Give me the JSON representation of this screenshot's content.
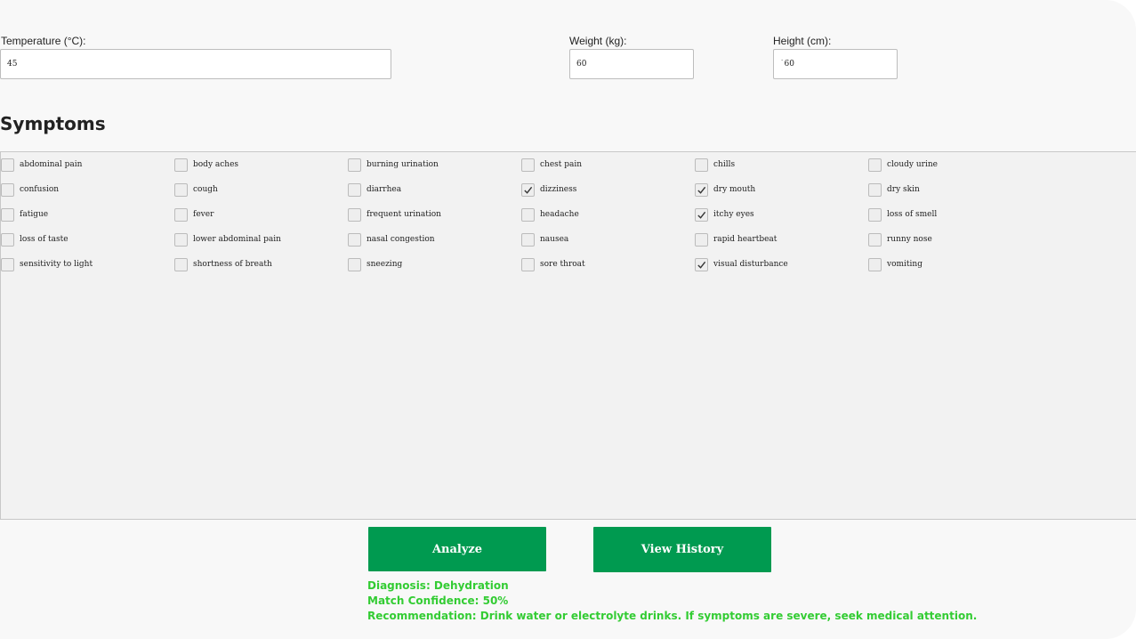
{
  "form": {
    "temperature_label": "Temperature (°C):",
    "temperature_value": "45",
    "weight_label": "Weight (kg):",
    "weight_value": "60",
    "height_label": "Height (cm):",
    "height_value": "`60"
  },
  "symptoms": {
    "title": "Symptoms",
    "items": [
      {
        "label": "abdominal pain",
        "checked": false
      },
      {
        "label": "body aches",
        "checked": false
      },
      {
        "label": "burning urination",
        "checked": false
      },
      {
        "label": "chest pain",
        "checked": false
      },
      {
        "label": "chills",
        "checked": false
      },
      {
        "label": "cloudy urine",
        "checked": false
      },
      {
        "label": "confusion",
        "checked": false
      },
      {
        "label": "cough",
        "checked": false
      },
      {
        "label": "diarrhea",
        "checked": false
      },
      {
        "label": "dizziness",
        "checked": true
      },
      {
        "label": "dry mouth",
        "checked": true
      },
      {
        "label": "dry skin",
        "checked": false
      },
      {
        "label": "fatigue",
        "checked": false
      },
      {
        "label": "fever",
        "checked": false
      },
      {
        "label": "frequent urination",
        "checked": false
      },
      {
        "label": "headache",
        "checked": false
      },
      {
        "label": "itchy eyes",
        "checked": true
      },
      {
        "label": "loss of smell",
        "checked": false
      },
      {
        "label": "loss of taste",
        "checked": false
      },
      {
        "label": "lower abdominal pain",
        "checked": false
      },
      {
        "label": "nasal congestion",
        "checked": false
      },
      {
        "label": "nausea",
        "checked": false
      },
      {
        "label": "rapid heartbeat",
        "checked": false
      },
      {
        "label": "runny nose",
        "checked": false
      },
      {
        "label": "sensitivity to light",
        "checked": false
      },
      {
        "label": "shortness of breath",
        "checked": false
      },
      {
        "label": "sneezing",
        "checked": false
      },
      {
        "label": "sore throat",
        "checked": false
      },
      {
        "label": "visual disturbance",
        "checked": true
      },
      {
        "label": "vomiting",
        "checked": false
      }
    ]
  },
  "actions": {
    "analyze_label": "Analyze",
    "history_label": "View History"
  },
  "result": {
    "diagnosis": "Diagnosis: Dehydration",
    "confidence": "Match Confidence: 50%",
    "recommendation": "Recommendation: Drink water or electrolyte drinks. If symptoms are severe, seek medical attention."
  },
  "colors": {
    "button": "#009a50",
    "result_text": "#33cc33"
  }
}
